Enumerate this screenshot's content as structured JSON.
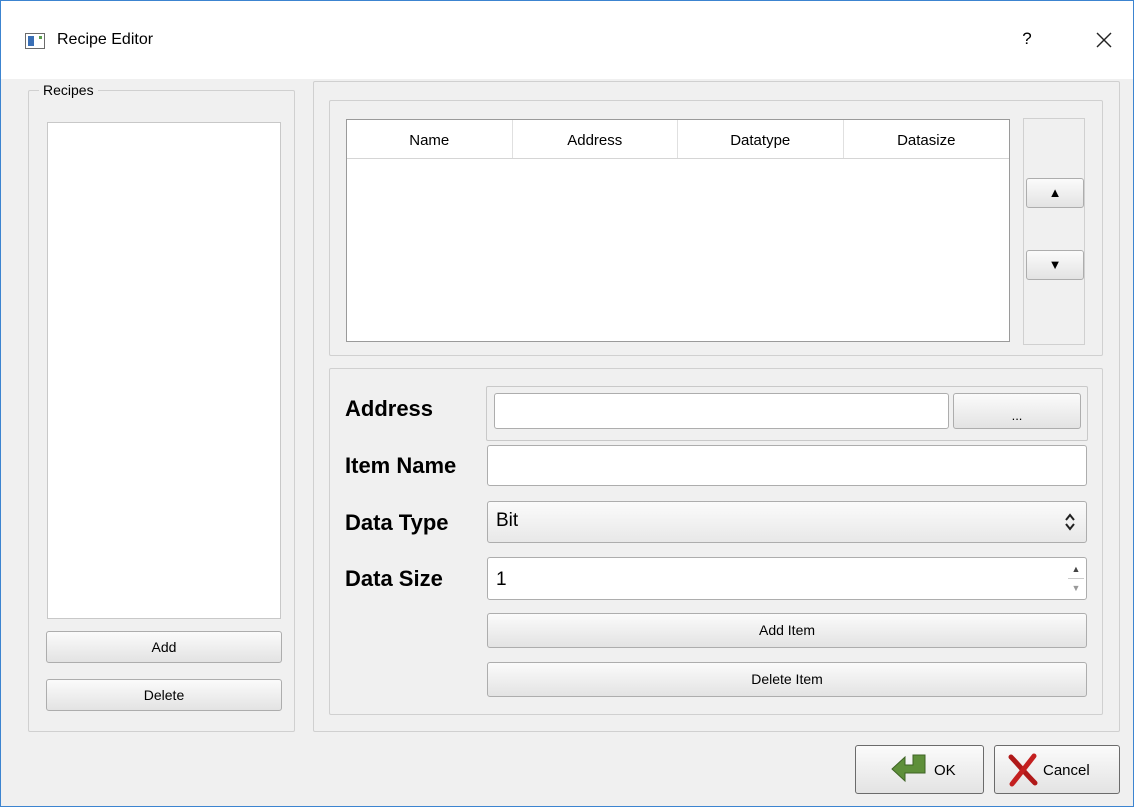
{
  "window": {
    "title": "Recipe Editor",
    "help": "?",
    "close": "×"
  },
  "recipes": {
    "group_title": "Recipes",
    "items": [],
    "add_label": "Add",
    "delete_label": "Delete"
  },
  "table": {
    "columns": [
      "Name",
      "Address",
      "Datatype",
      "Datasize"
    ],
    "rows": [],
    "move_up_label": "▲",
    "move_down_label": "▼"
  },
  "form": {
    "address_label": "Address",
    "address_value": "",
    "browse_label": "...",
    "item_name_label": "Item Name",
    "item_name_value": "",
    "data_type_label": "Data Type",
    "data_type_value": "Bit",
    "data_size_label": "Data Size",
    "data_size_value": "1",
    "add_item_label": "Add Item",
    "delete_item_label": "Delete Item"
  },
  "footer": {
    "ok_label": "OK",
    "cancel_label": "Cancel"
  }
}
